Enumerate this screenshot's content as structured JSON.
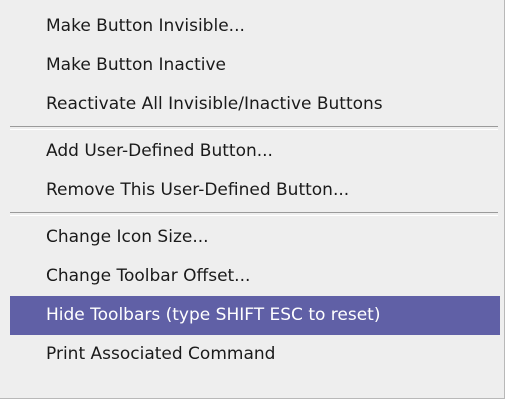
{
  "menu": {
    "highlight_color": "#6060a6",
    "groups": [
      {
        "items": [
          {
            "label": "Make Button Invisible..."
          },
          {
            "label": "Make Button Inactive"
          },
          {
            "label": "Reactivate All Invisible/Inactive Buttons"
          }
        ]
      },
      {
        "items": [
          {
            "label": "Add User-Defined Button..."
          },
          {
            "label": "Remove This User-Defined Button..."
          }
        ]
      },
      {
        "items": [
          {
            "label": "Change Icon Size..."
          },
          {
            "label": "Change Toolbar Offset..."
          },
          {
            "label": "Hide Toolbars (type SHIFT ESC to reset)",
            "highlighted": true
          },
          {
            "label": "Print Associated Command"
          }
        ]
      }
    ]
  }
}
